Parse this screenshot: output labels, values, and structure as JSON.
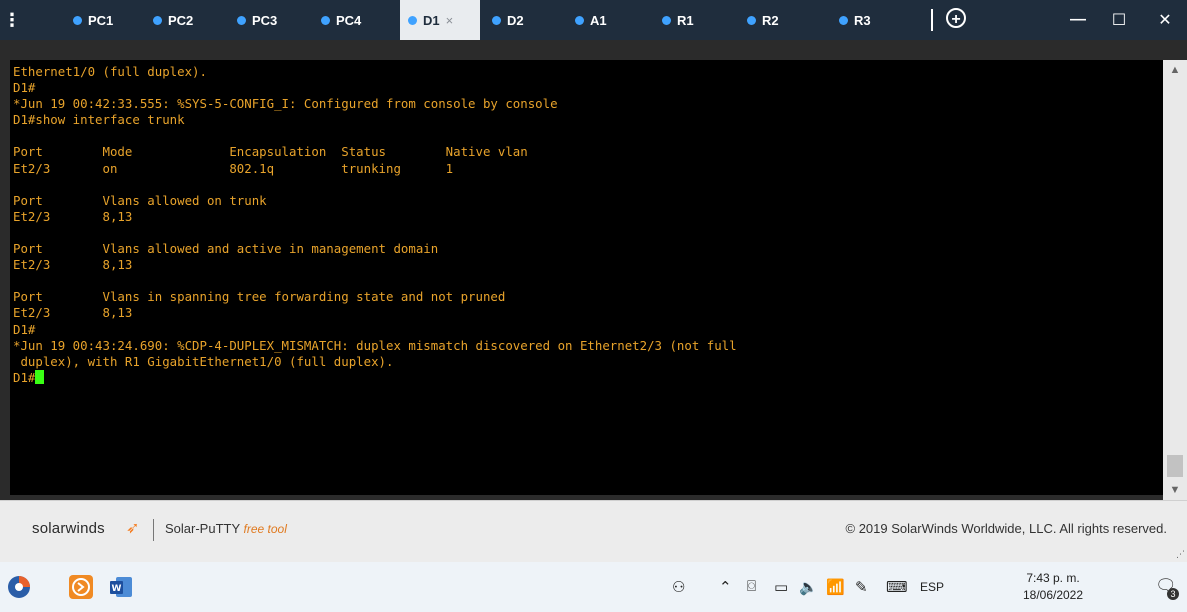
{
  "tabs": [
    {
      "label": "PC1"
    },
    {
      "label": "PC2"
    },
    {
      "label": "PC3"
    },
    {
      "label": "PC4"
    },
    {
      "label": "D1",
      "active": true,
      "close": "×"
    },
    {
      "label": "D2"
    },
    {
      "label": "A1"
    },
    {
      "label": "R1"
    },
    {
      "label": "R2"
    },
    {
      "label": "R3"
    }
  ],
  "menu_icon": "⋮",
  "new_tab_icon": "+",
  "window_controls": {
    "minimize": "—",
    "maximize": "☐",
    "close": "✕"
  },
  "terminal": {
    "lines": [
      "Ethernet1/0 (full duplex).",
      "D1#",
      "*Jun 19 00:42:33.555: %SYS-5-CONFIG_I: Configured from console by console",
      "D1#show interface trunk",
      "",
      "Port        Mode             Encapsulation  Status        Native vlan",
      "Et2/3       on               802.1q         trunking      1",
      "",
      "Port        Vlans allowed on trunk",
      "Et2/3       8,13",
      "",
      "Port        Vlans allowed and active in management domain",
      "Et2/3       8,13",
      "",
      "Port        Vlans in spanning tree forwarding state and not pruned",
      "Et2/3       8,13",
      "D1#",
      "*Jun 19 00:43:24.690: %CDP-4-DUPLEX_MISMATCH: duplex mismatch discovered on Ethernet2/3 (not full",
      " duplex), with R1 GigabitEthernet1/0 (full duplex).",
      "D1#"
    ],
    "text_color": "#e8a32b",
    "cursor_color": "#39ff14"
  },
  "footer": {
    "brand": "solarwinds",
    "product": "Solar-PuTTY",
    "product_tag": "free tool",
    "copyright": "© 2019 SolarWinds Worldwide, LLC. All rights reserved."
  },
  "taskbar": {
    "language": "ESP",
    "time": "7:43 p. m.",
    "date": "18/06/2022",
    "notification_count": "3"
  },
  "colors": {
    "tabbar": "#1f2d3d",
    "tab_dot": "#3fa2ff",
    "brand_orange": "#f47c20"
  }
}
